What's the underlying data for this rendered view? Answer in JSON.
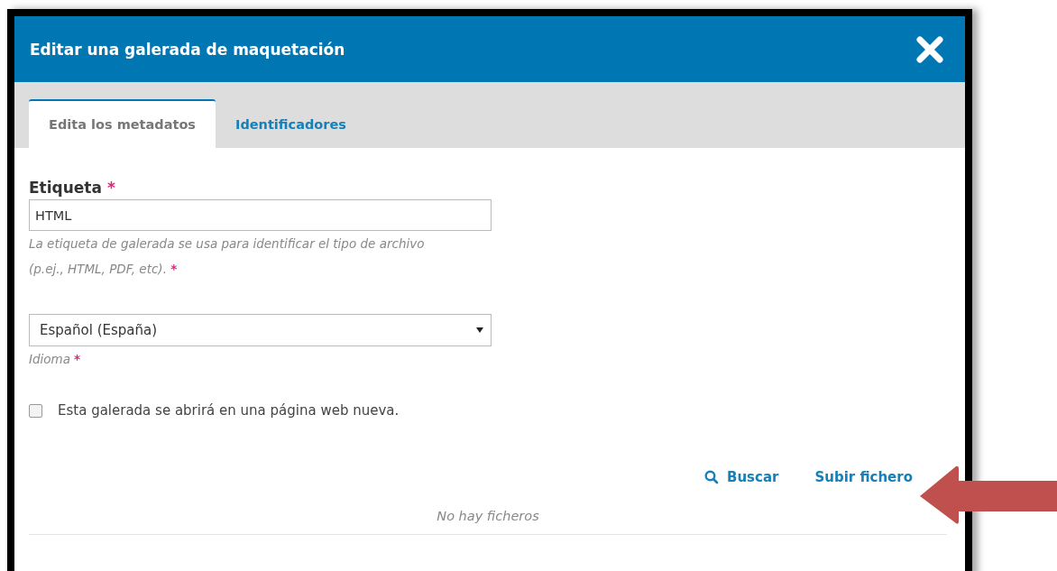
{
  "dialog": {
    "title": "Editar una galerada de maquetación"
  },
  "tabs": [
    {
      "label": "Edita los metadatos",
      "selected": true
    },
    {
      "label": "Identificadores",
      "selected": false
    }
  ],
  "label_field": {
    "label": "Etiqueta",
    "required_mark": "*",
    "value": "HTML",
    "help": "La etiqueta de galerada se usa para identificar el tipo de archivo (p.ej., HTML, PDF, etc).",
    "help_required_mark": "*"
  },
  "language_field": {
    "value": "Español (España)",
    "help": "Idioma",
    "required_mark": "*"
  },
  "remote_checkbox": {
    "label": "Esta galerada se abrirá en una página web nueva.",
    "checked": false
  },
  "file_actions": [
    {
      "kind": "search",
      "label": "Buscar"
    },
    {
      "kind": "upload",
      "label": "Subir fichero"
    }
  ],
  "files": {
    "empty_message": "No hay ficheros"
  }
}
